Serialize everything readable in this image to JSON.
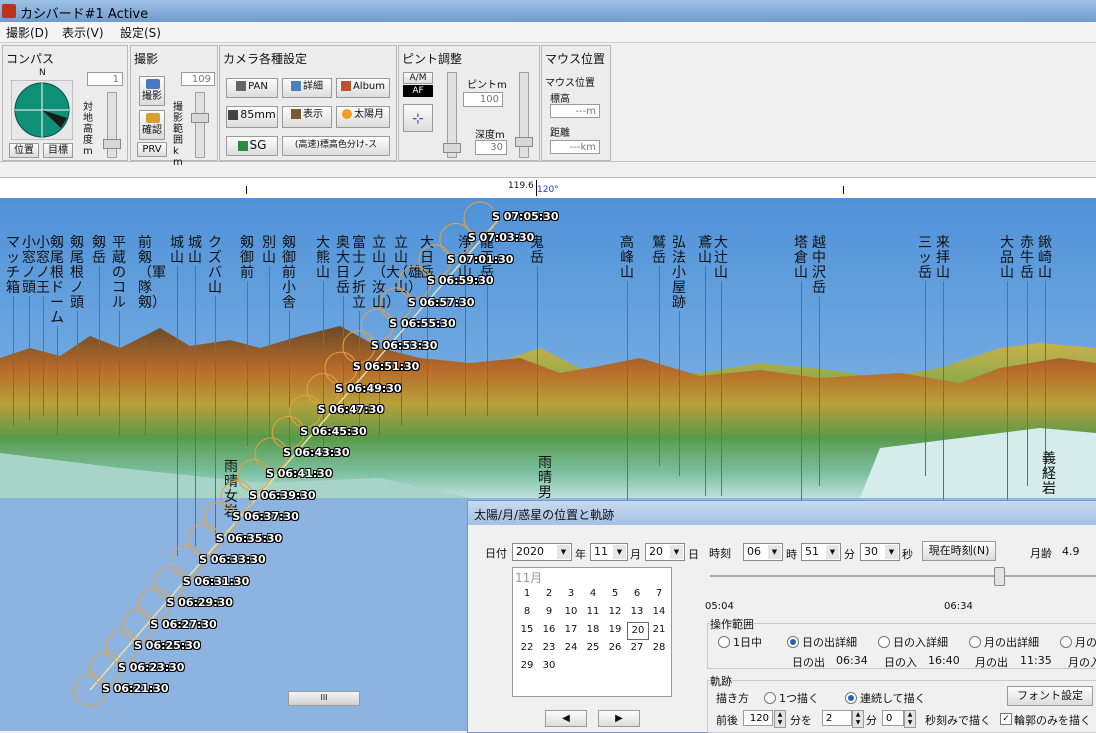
{
  "window": {
    "title": "カシバード#1 Active"
  },
  "menu": {
    "items": [
      "撮影(D)",
      "表示(V)",
      "設定(S)"
    ]
  },
  "compass": {
    "title": "コンパス",
    "north": "N",
    "pos_button": "位置",
    "target_button": "目標",
    "height_label": "対地高度m",
    "height_value": "1"
  },
  "shoot": {
    "title": "撮影",
    "shoot_button": "撮影",
    "confirm_button": "確認",
    "prv_button": "PRV",
    "range_label": "撮影範囲km",
    "range_value": "109"
  },
  "camera": {
    "title": "カメラ各種設定",
    "buttons": [
      "PAN",
      "詳細",
      "Album",
      "85mm",
      "表示",
      "太陽月",
      "SG",
      "(高速)標高色分け-ス"
    ]
  },
  "focus": {
    "title": "ピント調整",
    "am_label": "A/M",
    "af_label": "AF",
    "focus_label": "ピントm",
    "focus_value": "100",
    "depth_label": "深度m",
    "depth_value": "30"
  },
  "mouse": {
    "title": "マウス位置",
    "pos_label": "マウス位置",
    "elev_label": "標高",
    "elev_value": "---m",
    "dist_label": "距離",
    "dist_value": "---km"
  },
  "ruler": {
    "angle": "119.6",
    "heading": "120°"
  },
  "peaks": [
    {
      "label": "マッチ箱"
    },
    {
      "label": "小窓ノ頭"
    },
    {
      "label": "小窓ノ王"
    },
    {
      "label": "剱尾根ドーム"
    },
    {
      "label": "剱尾根ノ頭"
    },
    {
      "label": "剱岳"
    },
    {
      "label": "平蔵のコル"
    },
    {
      "label": "前剱（軍隊剱）"
    },
    {
      "label": "城山"
    },
    {
      "label": "城山"
    },
    {
      "label": "クズバ山"
    },
    {
      "label": "剱御前"
    },
    {
      "label": "別山"
    },
    {
      "label": "剱御前小舎"
    },
    {
      "label": "大熊山"
    },
    {
      "label": "奥大日岳"
    },
    {
      "label": "富士ノ折立"
    },
    {
      "label": "立山（大汝山）"
    },
    {
      "label": "立山（雄山）"
    },
    {
      "label": "大日岳"
    },
    {
      "label": "浄土山"
    },
    {
      "label": "龍王岳"
    },
    {
      "label": "鬼岳"
    },
    {
      "label": "高峰山"
    },
    {
      "label": "鷲岳"
    },
    {
      "label": "弘法小屋跡"
    },
    {
      "label": "鳶山"
    },
    {
      "label": "大辻山"
    },
    {
      "label": "塔倉山"
    },
    {
      "label": "越中沢岳"
    },
    {
      "label": "三ッ岳"
    },
    {
      "label": "来拝山"
    },
    {
      "label": "大品山"
    },
    {
      "label": "赤牛岳"
    },
    {
      "label": "鍬崎山"
    },
    {
      "label": "雨晴男"
    },
    {
      "label": "雨晴女岩"
    },
    {
      "label": "義経岩"
    }
  ],
  "sun_times": [
    "S 07:05:30",
    "S 07:03:30",
    "S 07:01:30",
    "S 06:59:30",
    "S 06:57:30",
    "S 06:55:30",
    "S 06:53:30",
    "S 06:51:30",
    "S 06:49:30",
    "S 06:47:30",
    "S 06:45:30",
    "S 06:43:30",
    "S 06:41:30",
    "S 06:39:30",
    "S 06:37:30",
    "S 06:35:30",
    "S 06:33:30",
    "S 06:31:30",
    "S 06:29:30",
    "S 06:27:30",
    "S 06:25:30",
    "S 06:23:30",
    "S 06:21:30"
  ],
  "scrollbar": {
    "grip": "III"
  },
  "dialog": {
    "title": "太陽/月/惑星の位置と軌跡",
    "date_label": "日付",
    "year": "2020",
    "year_unit": "年",
    "month": "11",
    "month_unit": "月",
    "day": "20",
    "day_unit": "日",
    "time_label": "時刻",
    "hour": "06",
    "hour_unit": "時",
    "minute": "51",
    "minute_unit": "分",
    "second": "30",
    "second_unit": "秒",
    "now_button": "現在時刻(N)",
    "moon_age_label": "月齢",
    "moon_age": "4.9",
    "calendar_month": "11月",
    "calendar_days": [
      "1",
      "2",
      "3",
      "4",
      "5",
      "6",
      "7",
      "8",
      "9",
      "10",
      "11",
      "12",
      "13",
      "14",
      "15",
      "16",
      "17",
      "18",
      "19",
      "20",
      "21",
      "22",
      "23",
      "24",
      "25",
      "26",
      "27",
      "28",
      "29",
      "30"
    ],
    "slider_start": "05:04",
    "slider_mid": "06:34",
    "range_title": "操作範囲",
    "range_options": [
      "1日中",
      "日の出詳細",
      "日の入詳細",
      "月の出詳細",
      "月の"
    ],
    "rise_set": [
      {
        "label": "日の出",
        "time": "06:34"
      },
      {
        "label": "日の入",
        "time": "16:40"
      },
      {
        "label": "月の出",
        "time": "11:35"
      },
      {
        "label": "月の入",
        "time": ""
      }
    ],
    "trail_title": "軌跡",
    "draw_label": "描き方",
    "draw_once": "1つ描く",
    "draw_cont": "連続して描く",
    "font_button": "フォント設定",
    "before_after_label": "前後",
    "before_after_value": "120",
    "min_label": "分を",
    "step_value": "2",
    "step_unit": "分",
    "sec_value": "0",
    "sec_label": "秒刻みで描く",
    "outline_only": "輪郭のみを描く"
  }
}
